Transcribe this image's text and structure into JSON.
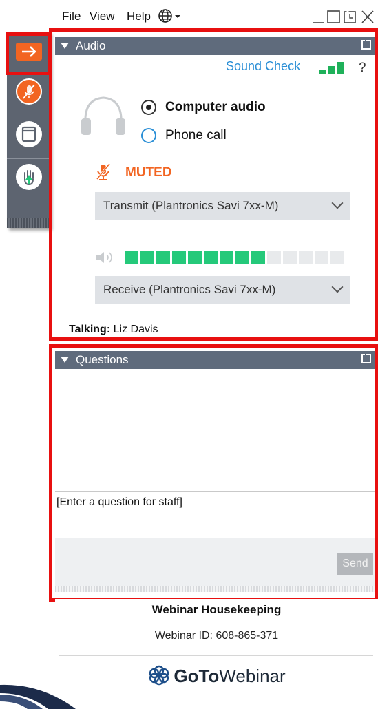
{
  "menubar": {
    "file": "File",
    "view": "View",
    "help": "Help"
  },
  "audio": {
    "panel_title": "Audio",
    "sound_check": "Sound Check",
    "help": "?",
    "options": [
      {
        "label": "Computer audio",
        "selected": true
      },
      {
        "label": "Phone call",
        "selected": false
      }
    ],
    "muted_label": "MUTED",
    "transmit_device": "Transmit (Plantronics Savi 7xx-M)",
    "receive_device": "Receive (Plantronics Savi 7xx-M)",
    "speaker_level": {
      "active_segments": 9,
      "total_segments": 14
    },
    "talking_label": "Talking:",
    "talking_name": "Liz Davis"
  },
  "questions": {
    "panel_title": "Questions",
    "placeholder": "[Enter a question for staff]",
    "send_label": "Send"
  },
  "footer": {
    "title": "Webinar Housekeeping",
    "webinar_id": "Webinar ID: 608-865-371",
    "brand_bold": "GoTo",
    "brand_light": "Webinar"
  },
  "colors": {
    "accent_orange": "#f26522",
    "level_green": "#25c97a",
    "panel_header": "#5f6b7c",
    "link_blue": "#2b8fd6",
    "highlight_red": "#e81010"
  }
}
